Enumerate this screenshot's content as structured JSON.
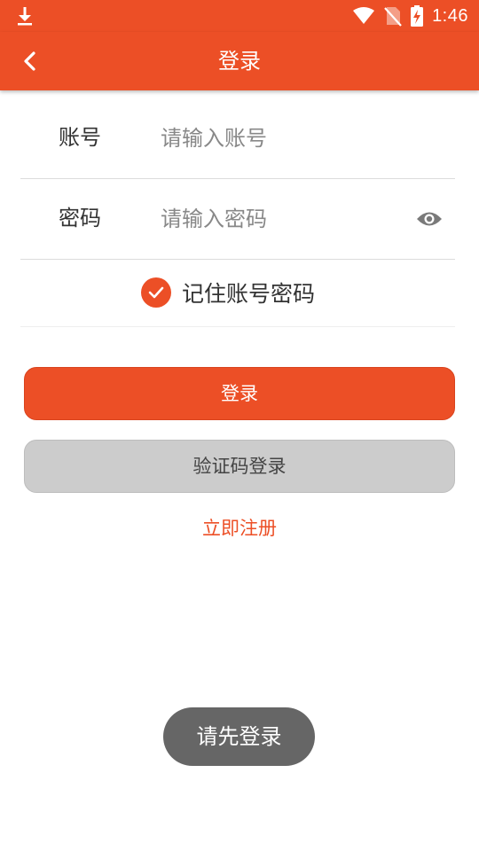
{
  "status_bar": {
    "time": "1:46",
    "icons": [
      "download-icon",
      "wifi-icon",
      "no-sim-icon",
      "battery-charging-icon"
    ]
  },
  "app_bar": {
    "title": "登录",
    "back_icon": "chevron-left-icon"
  },
  "form": {
    "account": {
      "label": "账号",
      "placeholder": "请输入账号",
      "value": ""
    },
    "password": {
      "label": "密码",
      "placeholder": "请输入密码",
      "value": "",
      "toggle_icon": "eye-icon"
    },
    "remember": {
      "label": "记住账号密码",
      "checked": true
    }
  },
  "buttons": {
    "login_label": "登录",
    "sms_login_label": "验证码登录",
    "register_label": "立即注册"
  },
  "toast": {
    "message": "请先登录"
  },
  "colors": {
    "primary": "#ec4f26",
    "button_disabled": "#cccccc",
    "toast_bg": "#666666",
    "divider": "#dcdcdc"
  }
}
